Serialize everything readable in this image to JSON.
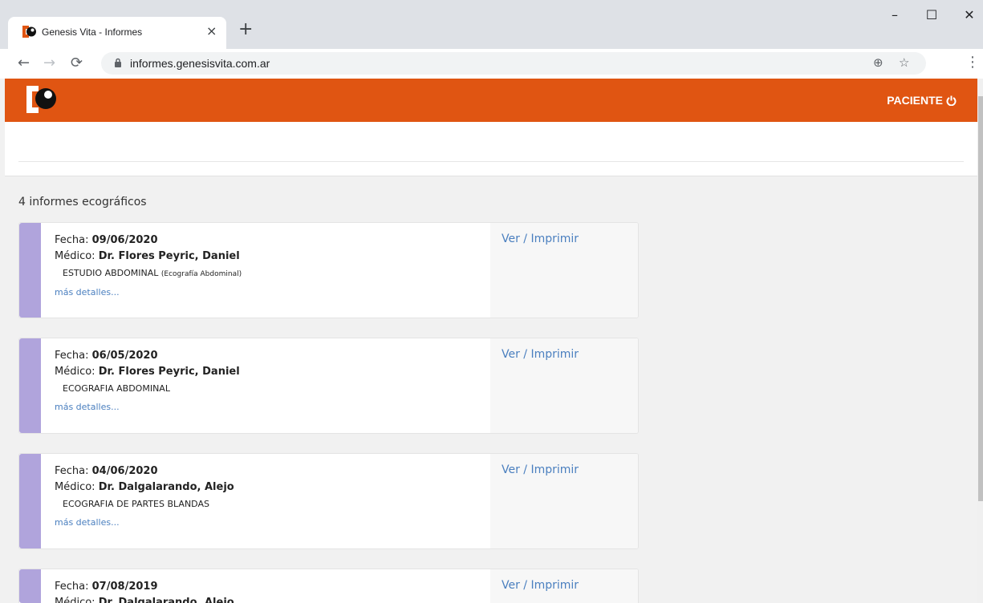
{
  "browser": {
    "tab_title": "Genesis Vita - Informes",
    "tab_close": "×",
    "new_tab": "+",
    "url": "informes.genesisvita.com.ar",
    "window_controls": {
      "minimize": "–",
      "maximize": "☐",
      "close": "✕"
    }
  },
  "header": {
    "user_label": "PACIENTE",
    "brand_color": "#e05512"
  },
  "list": {
    "count_label": "4 informes ecográficos",
    "fecha_label": "Fecha:",
    "medico_label": "Médico:",
    "action_label": "Ver / Imprimir",
    "details_label": "más detalles...",
    "items": [
      {
        "fecha": "09/06/2020",
        "medico": "Dr. Flores Peyric, Daniel",
        "estudio": "ESTUDIO ABDOMINAL",
        "estudio_tipo": "(Ecografía Abdominal)"
      },
      {
        "fecha": "06/05/2020",
        "medico": "Dr. Flores Peyric, Daniel",
        "estudio": "ECOGRAFIA ABDOMINAL",
        "estudio_tipo": ""
      },
      {
        "fecha": "04/06/2020",
        "medico": "Dr. Dalgalarando, Alejo",
        "estudio": "ECOGRAFIA DE PARTES BLANDAS",
        "estudio_tipo": ""
      },
      {
        "fecha": "07/08/2019",
        "medico": "Dr. Dalgalarando, Alejo",
        "estudio": "",
        "estudio_tipo": ""
      }
    ]
  }
}
